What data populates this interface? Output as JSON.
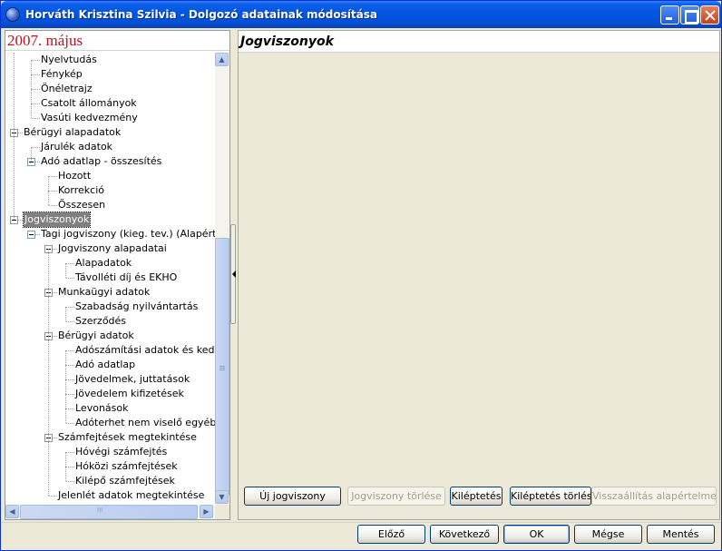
{
  "window": {
    "title": "Horváth  Krisztina Szilvia - Dolgozó adatainak módosítása"
  },
  "left": {
    "period": "2007. május",
    "tree": [
      {
        "label": "Nyelvtudás",
        "level": 2
      },
      {
        "label": "Fénykép",
        "level": 2
      },
      {
        "label": "Önéletrajz",
        "level": 2
      },
      {
        "label": "Csatolt állományok",
        "level": 2
      },
      {
        "label": "Vasúti kedvezmény",
        "level": 2
      },
      {
        "label": "Bérügyi alapadatok",
        "level": 1,
        "expanded": true
      },
      {
        "label": "Járulék adatok",
        "level": 2
      },
      {
        "label": "Adó adatlap - összesítés",
        "level": 2,
        "expanded": true
      },
      {
        "label": "Hozott",
        "level": 3
      },
      {
        "label": "Korrekció",
        "level": 3
      },
      {
        "label": "Összesen",
        "level": 3
      },
      {
        "label": "Jogviszonyok",
        "level": 1,
        "expanded": true,
        "selected": true
      },
      {
        "label": "Tagi jogviszony (kieg. tev.) (Alapértelm",
        "level": 2,
        "expanded": true
      },
      {
        "label": "Jogviszony alapadatai",
        "level": 3,
        "expanded": true
      },
      {
        "label": "Alapadatok",
        "level": 4
      },
      {
        "label": "Távolléti díj és EKHO",
        "level": 4
      },
      {
        "label": "Munkaügyi adatok",
        "level": 3,
        "expanded": true
      },
      {
        "label": "Szabadság nyilvántartás",
        "level": 4
      },
      {
        "label": "Szerződés",
        "level": 4
      },
      {
        "label": "Bérügyi adatok",
        "level": 3,
        "expanded": true
      },
      {
        "label": "Adószámítási adatok és kedvez",
        "level": 4
      },
      {
        "label": "Adó adatlap",
        "level": 4
      },
      {
        "label": "Jövedelmek, juttatások",
        "level": 4
      },
      {
        "label": "Jövedelem kifizetések",
        "level": 4
      },
      {
        "label": "Levonások",
        "level": 4
      },
      {
        "label": "Adóterhet nem viselő egyéb jár",
        "level": 4
      },
      {
        "label": "Számfejtések megtekintése",
        "level": 3,
        "expanded": true
      },
      {
        "label": "Hóvégi számfejtés",
        "level": 4
      },
      {
        "label": "Hóközi számfejtések",
        "level": 4
      },
      {
        "label": "Kilépő számfejtések",
        "level": 4
      },
      {
        "label": "Jelenlét adatok megtekintése",
        "level": 3
      }
    ],
    "hscroll_grip": "III"
  },
  "right": {
    "title": "Jogviszonyok",
    "buttons": {
      "new": "Új jogviszony",
      "delete": "Jogviszony törlése",
      "exit": "Kiléptetés",
      "exit_delete": "Kiléptetés törlése",
      "reset": "Visszaállítás alapértelmezettnek"
    }
  },
  "footer": {
    "prev": "Előző",
    "next": "Következő",
    "ok": "OK",
    "cancel": "Mégse",
    "save": "Mentés"
  }
}
